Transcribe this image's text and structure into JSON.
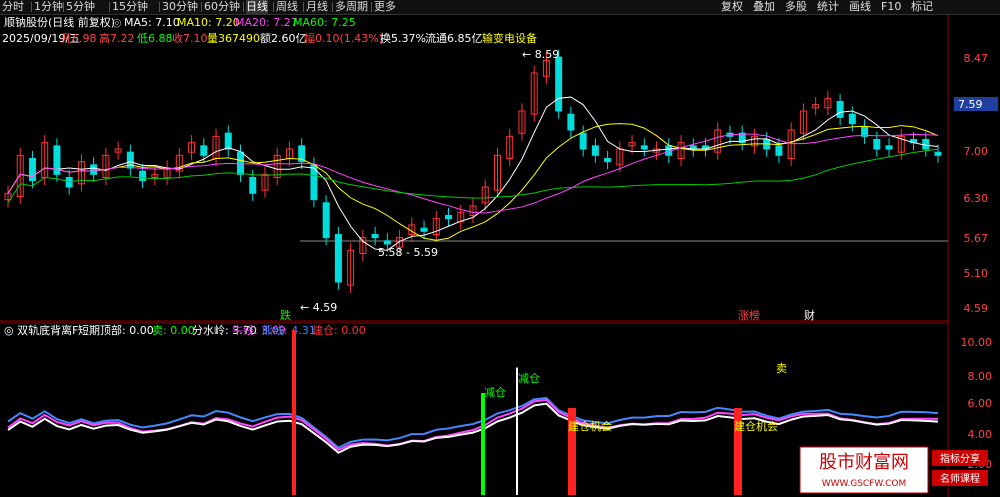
{
  "toolbar": {
    "left": [
      "分时",
      "1分钟",
      "5分钟",
      "15分钟",
      "30分钟",
      "60分钟",
      "日线",
      "周线",
      "月线",
      "多周期",
      "更多"
    ],
    "active": "日线",
    "right": [
      "复权",
      "叠加",
      "多股",
      "统计",
      "画线",
      "F10",
      "标记"
    ],
    "icons": [
      "settings-icon",
      "close-icon"
    ]
  },
  "header": {
    "title": "顺钠股份(日线 前复权)",
    "ma": [
      {
        "label": "MA5:",
        "value": "7.10",
        "color": "#ffffff"
      },
      {
        "label": "MA10:",
        "value": "7.20",
        "color": "#ffff00"
      },
      {
        "label": "MA20:",
        "value": "7.27",
        "color": "#ff44ff"
      },
      {
        "label": "MA60:",
        "value": "7.25",
        "color": "#00ff00"
      }
    ]
  },
  "info": {
    "date": "2025/09/19/五",
    "open_label": "开",
    "open": "6.98",
    "high_label": "高",
    "high": "7.22",
    "low_label": "低",
    "low": "6.88",
    "close_label": "收",
    "close": "7.10",
    "vol_label": "量",
    "vol": "367490",
    "amount_label": "额",
    "amount": "2.60亿",
    "change_label": "幅",
    "change": "0.10(1.43%)",
    "turnover_label": "换",
    "turnover": "5.37%",
    "float_label": "流通",
    "float": "6.85亿",
    "sector": "输变电设备"
  },
  "price_axis": [
    "8.47",
    "7.59",
    "7.00",
    "6.30",
    "5.67",
    "5.10",
    "4.59"
  ],
  "price_annotations": {
    "high": "8.59",
    "low": "4.59",
    "range": "5.58 - 5.59",
    "current_price": "7.59"
  },
  "event_labels": [
    {
      "text": "跌",
      "color": "#00ff00"
    },
    {
      "text": "涨榜",
      "color": "#ff4444"
    },
    {
      "text": "财",
      "color": "#ffffff"
    }
  ],
  "indicator": {
    "title": "双轨底背离F",
    "items": [
      {
        "label": "短期顶部:",
        "value": "0.00",
        "color": "#ffffff"
      },
      {
        "label": "卖:",
        "value": "0.00",
        "color": "#00ff00"
      },
      {
        "label": "分水岭:",
        "value": "3.70",
        "color": "#ffffff"
      },
      {
        "label": "牛线:",
        "value": "3.09",
        "color": "#ff44ff"
      },
      {
        "label": "熊线:",
        "value": "4.31",
        "color": "#4488ff"
      },
      {
        "label": "建仓:",
        "value": "0.00",
        "color": "#ff3333"
      }
    ],
    "axis": [
      "10.00",
      "8.00",
      "6.00",
      "4.00",
      "2.00"
    ],
    "signals": [
      "减仓",
      "减仓",
      "建仓机会",
      "卖",
      "建仓机会"
    ]
  },
  "watermark": {
    "line1": "股市财富网",
    "line2": "WWW.GSCFW.COM",
    "tag1": "指标分享",
    "tag2": "名师课程"
  },
  "chart_data": {
    "type": "line",
    "price": {
      "ohlc_close_approx": [
        6.3,
        6.9,
        6.5,
        7.1,
        6.6,
        6.4,
        6.8,
        6.6,
        6.9,
        7.0,
        6.7,
        6.5,
        6.6,
        6.7,
        6.9,
        7.1,
        6.9,
        7.2,
        7.0,
        6.6,
        6.3,
        6.6,
        6.9,
        7.0,
        6.8,
        6.2,
        5.6,
        4.9,
        5.4,
        5.6,
        5.6,
        5.5,
        5.6,
        5.8,
        5.7,
        5.9,
        5.9,
        6.0,
        6.1,
        6.4,
        6.9,
        7.2,
        7.6,
        8.2,
        8.4,
        7.6,
        7.3,
        7.0,
        6.9,
        6.8,
        7.0,
        7.1,
        7.0,
        7.0,
        6.9,
        7.1,
        7.0,
        7.0,
        7.3,
        7.2,
        7.1,
        7.2,
        7.0,
        6.9,
        7.3,
        7.6,
        7.7,
        7.8,
        7.5,
        7.4,
        7.2,
        7.0,
        7.0,
        7.2,
        7.1,
        7.0,
        6.9
      ],
      "ylim": [
        4.3,
        8.8
      ]
    },
    "indicator_ylim": [
      0,
      11
    ]
  }
}
